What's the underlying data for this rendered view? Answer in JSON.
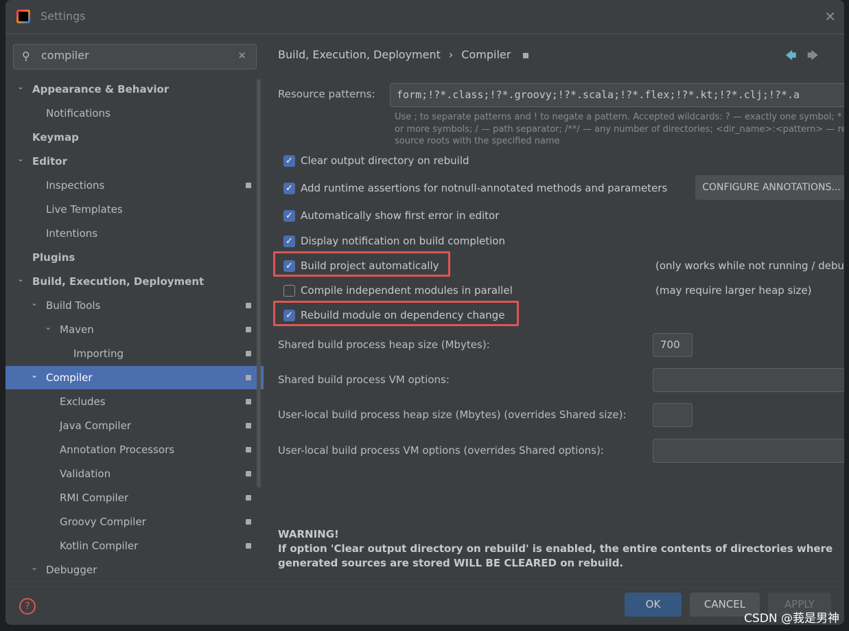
{
  "window": {
    "title": "Settings"
  },
  "search": {
    "value": "compiler"
  },
  "tree": [
    {
      "label": "Appearance & Behavior",
      "level": 0,
      "expanded": true
    },
    {
      "label": "Notifications",
      "level": 1
    },
    {
      "label": "Keymap",
      "level": 0
    },
    {
      "label": "Editor",
      "level": 0,
      "expanded": true
    },
    {
      "label": "Inspections",
      "level": 1,
      "badge": true
    },
    {
      "label": "Live Templates",
      "level": 1
    },
    {
      "label": "Intentions",
      "level": 1
    },
    {
      "label": "Plugins",
      "level": 0
    },
    {
      "label": "Build, Execution, Deployment",
      "level": 0,
      "expanded": true
    },
    {
      "label": "Build Tools",
      "level": 1,
      "expanded": true,
      "badge": true
    },
    {
      "label": "Maven",
      "level": 2,
      "expanded": true,
      "badge": true
    },
    {
      "label": "Importing",
      "level": 3,
      "badge": true
    },
    {
      "label": "Compiler",
      "level": 1,
      "expanded": true,
      "badge": true,
      "selected": true
    },
    {
      "label": "Excludes",
      "level": 2,
      "badge": true
    },
    {
      "label": "Java Compiler",
      "level": 2,
      "badge": true
    },
    {
      "label": "Annotation Processors",
      "level": 2,
      "badge": true
    },
    {
      "label": "Validation",
      "level": 2,
      "badge": true
    },
    {
      "label": "RMI Compiler",
      "level": 2,
      "badge": true
    },
    {
      "label": "Groovy Compiler",
      "level": 2,
      "badge": true
    },
    {
      "label": "Kotlin Compiler",
      "level": 2,
      "badge": true
    },
    {
      "label": "Debugger",
      "level": 1,
      "expanded": true
    }
  ],
  "breadcrumb": {
    "parent": "Build, Execution, Deployment",
    "current": "Compiler"
  },
  "resource": {
    "label": "Resource patterns:",
    "value": "form;!?*.class;!?*.groovy;!?*.scala;!?*.flex;!?*.kt;!?*.clj;!?*.a",
    "hint": [
      "Use ; to separate patterns and ! to negate a pattern. Accepted wildcards: ? — exactly one symbol; *",
      "or more symbols; / — path separator; /**/ — any number of directories; <dir_name>:<pattern> — res",
      "source roots with the specified name"
    ]
  },
  "options": [
    {
      "label": "Clear output directory on rebuild",
      "checked": true
    },
    {
      "label": "Add runtime assertions for notnull-annotated methods and parameters",
      "checked": true
    },
    {
      "label": "Automatically show first error in editor",
      "checked": true
    },
    {
      "label": "Display notification on build completion",
      "checked": true
    },
    {
      "label": "Build project automatically",
      "checked": true,
      "highlighted": true
    },
    {
      "label": "Compile independent modules in parallel",
      "checked": false
    },
    {
      "label": "Rebuild module on dependency change",
      "checked": true,
      "highlighted": true
    }
  ],
  "configure_button": "CONFIGURE ANNOTATIONS...",
  "notes": {
    "auto": "(only works while not running / debu",
    "parallel": "(may require larger heap size)"
  },
  "fields": [
    {
      "label": "Shared build process heap size (Mbytes):",
      "value": "700"
    },
    {
      "label": "Shared build process VM options:",
      "value": ""
    },
    {
      "label": "User-local build process heap size (Mbytes) (overrides Shared size):",
      "value": ""
    },
    {
      "label": "User-local build process VM options (overrides Shared options):",
      "value": ""
    }
  ],
  "warning": {
    "title": "WARNING!",
    "lines": [
      "If option 'Clear output directory on rebuild' is enabled, the entire contents of directories where",
      "generated sources are stored WILL BE CLEARED on rebuild."
    ]
  },
  "buttons": {
    "ok": "OK",
    "cancel": "CANCEL",
    "apply": "APPLY"
  },
  "watermark": "CSDN @莪是男神",
  "colors": {
    "accent": "#4b6eaf",
    "highlight": "#e05555",
    "background": "#3c3f41"
  }
}
